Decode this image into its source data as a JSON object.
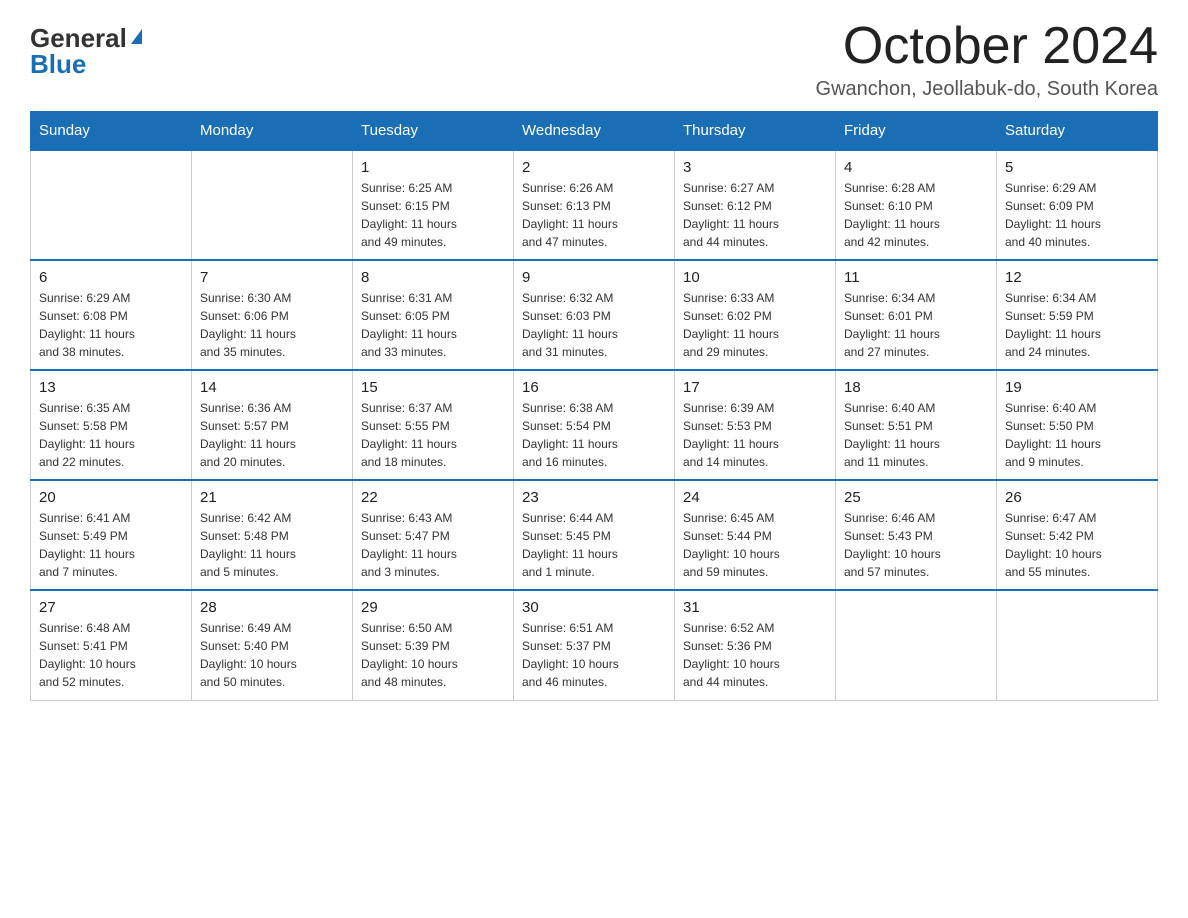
{
  "logo": {
    "general": "General",
    "blue": "Blue",
    "triangle": "▶"
  },
  "title": "October 2024",
  "location": "Gwanchon, Jeollabuk-do, South Korea",
  "days_of_week": [
    "Sunday",
    "Monday",
    "Tuesday",
    "Wednesday",
    "Thursday",
    "Friday",
    "Saturday"
  ],
  "weeks": [
    [
      {
        "num": "",
        "info": ""
      },
      {
        "num": "",
        "info": ""
      },
      {
        "num": "1",
        "info": "Sunrise: 6:25 AM\nSunset: 6:15 PM\nDaylight: 11 hours\nand 49 minutes."
      },
      {
        "num": "2",
        "info": "Sunrise: 6:26 AM\nSunset: 6:13 PM\nDaylight: 11 hours\nand 47 minutes."
      },
      {
        "num": "3",
        "info": "Sunrise: 6:27 AM\nSunset: 6:12 PM\nDaylight: 11 hours\nand 44 minutes."
      },
      {
        "num": "4",
        "info": "Sunrise: 6:28 AM\nSunset: 6:10 PM\nDaylight: 11 hours\nand 42 minutes."
      },
      {
        "num": "5",
        "info": "Sunrise: 6:29 AM\nSunset: 6:09 PM\nDaylight: 11 hours\nand 40 minutes."
      }
    ],
    [
      {
        "num": "6",
        "info": "Sunrise: 6:29 AM\nSunset: 6:08 PM\nDaylight: 11 hours\nand 38 minutes."
      },
      {
        "num": "7",
        "info": "Sunrise: 6:30 AM\nSunset: 6:06 PM\nDaylight: 11 hours\nand 35 minutes."
      },
      {
        "num": "8",
        "info": "Sunrise: 6:31 AM\nSunset: 6:05 PM\nDaylight: 11 hours\nand 33 minutes."
      },
      {
        "num": "9",
        "info": "Sunrise: 6:32 AM\nSunset: 6:03 PM\nDaylight: 11 hours\nand 31 minutes."
      },
      {
        "num": "10",
        "info": "Sunrise: 6:33 AM\nSunset: 6:02 PM\nDaylight: 11 hours\nand 29 minutes."
      },
      {
        "num": "11",
        "info": "Sunrise: 6:34 AM\nSunset: 6:01 PM\nDaylight: 11 hours\nand 27 minutes."
      },
      {
        "num": "12",
        "info": "Sunrise: 6:34 AM\nSunset: 5:59 PM\nDaylight: 11 hours\nand 24 minutes."
      }
    ],
    [
      {
        "num": "13",
        "info": "Sunrise: 6:35 AM\nSunset: 5:58 PM\nDaylight: 11 hours\nand 22 minutes."
      },
      {
        "num": "14",
        "info": "Sunrise: 6:36 AM\nSunset: 5:57 PM\nDaylight: 11 hours\nand 20 minutes."
      },
      {
        "num": "15",
        "info": "Sunrise: 6:37 AM\nSunset: 5:55 PM\nDaylight: 11 hours\nand 18 minutes."
      },
      {
        "num": "16",
        "info": "Sunrise: 6:38 AM\nSunset: 5:54 PM\nDaylight: 11 hours\nand 16 minutes."
      },
      {
        "num": "17",
        "info": "Sunrise: 6:39 AM\nSunset: 5:53 PM\nDaylight: 11 hours\nand 14 minutes."
      },
      {
        "num": "18",
        "info": "Sunrise: 6:40 AM\nSunset: 5:51 PM\nDaylight: 11 hours\nand 11 minutes."
      },
      {
        "num": "19",
        "info": "Sunrise: 6:40 AM\nSunset: 5:50 PM\nDaylight: 11 hours\nand 9 minutes."
      }
    ],
    [
      {
        "num": "20",
        "info": "Sunrise: 6:41 AM\nSunset: 5:49 PM\nDaylight: 11 hours\nand 7 minutes."
      },
      {
        "num": "21",
        "info": "Sunrise: 6:42 AM\nSunset: 5:48 PM\nDaylight: 11 hours\nand 5 minutes."
      },
      {
        "num": "22",
        "info": "Sunrise: 6:43 AM\nSunset: 5:47 PM\nDaylight: 11 hours\nand 3 minutes."
      },
      {
        "num": "23",
        "info": "Sunrise: 6:44 AM\nSunset: 5:45 PM\nDaylight: 11 hours\nand 1 minute."
      },
      {
        "num": "24",
        "info": "Sunrise: 6:45 AM\nSunset: 5:44 PM\nDaylight: 10 hours\nand 59 minutes."
      },
      {
        "num": "25",
        "info": "Sunrise: 6:46 AM\nSunset: 5:43 PM\nDaylight: 10 hours\nand 57 minutes."
      },
      {
        "num": "26",
        "info": "Sunrise: 6:47 AM\nSunset: 5:42 PM\nDaylight: 10 hours\nand 55 minutes."
      }
    ],
    [
      {
        "num": "27",
        "info": "Sunrise: 6:48 AM\nSunset: 5:41 PM\nDaylight: 10 hours\nand 52 minutes."
      },
      {
        "num": "28",
        "info": "Sunrise: 6:49 AM\nSunset: 5:40 PM\nDaylight: 10 hours\nand 50 minutes."
      },
      {
        "num": "29",
        "info": "Sunrise: 6:50 AM\nSunset: 5:39 PM\nDaylight: 10 hours\nand 48 minutes."
      },
      {
        "num": "30",
        "info": "Sunrise: 6:51 AM\nSunset: 5:37 PM\nDaylight: 10 hours\nand 46 minutes."
      },
      {
        "num": "31",
        "info": "Sunrise: 6:52 AM\nSunset: 5:36 PM\nDaylight: 10 hours\nand 44 minutes."
      },
      {
        "num": "",
        "info": ""
      },
      {
        "num": "",
        "info": ""
      }
    ]
  ]
}
